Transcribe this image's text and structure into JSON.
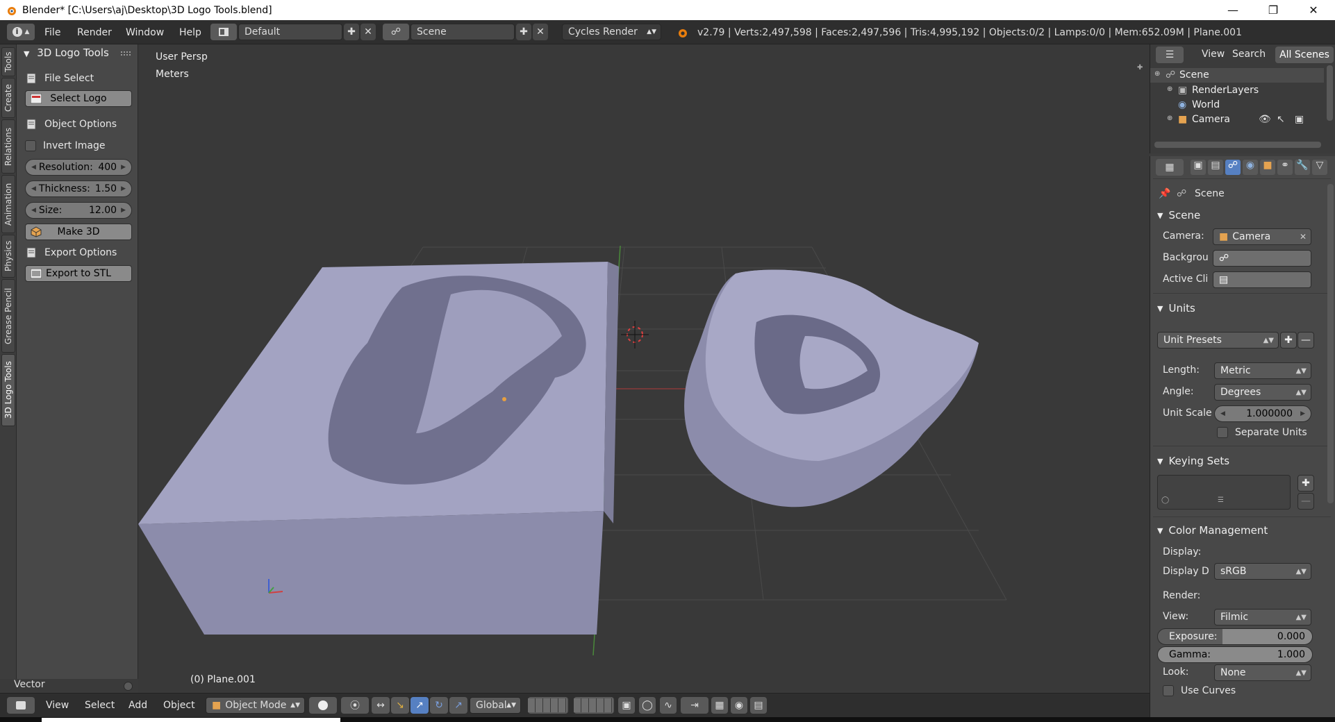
{
  "window": {
    "title": "Blender* [C:\\Users\\aj\\Desktop\\3D Logo Tools.blend]"
  },
  "infobar": {
    "menus": [
      "File",
      "Render",
      "Window",
      "Help"
    ],
    "layout": "Default",
    "scene": "Scene",
    "engine": "Cycles Render",
    "stats": "v2.79 | Verts:2,497,598 | Faces:2,497,596 | Tris:4,995,192 | Objects:0/2 | Lamps:0/0 | Mem:652.09M | Plane.001"
  },
  "tool_tabs": [
    "Tools",
    "Create",
    "Relations",
    "Animation",
    "Physics",
    "Grease Pencil",
    "3D Logo Tools"
  ],
  "tool_panel": {
    "title": "3D Logo Tools",
    "file_select": "File Select",
    "select_logo": "Select Logo",
    "object_options": "Object Options",
    "invert_image": "Invert Image",
    "resolution_label": "Resolution:",
    "resolution_value": "400",
    "thickness_label": "Thickness:",
    "thickness_value": "1.50",
    "size_label": "Size:",
    "size_value": "12.00",
    "make_3d": "Make 3D",
    "export_options": "Export Options",
    "export_stl": "Export to STL",
    "vector": "Vector"
  },
  "viewport": {
    "view_name": "User Persp",
    "units": "Meters",
    "object_label": "(0) Plane.001"
  },
  "bottombar": {
    "menus": [
      "View",
      "Select",
      "Add",
      "Object"
    ],
    "mode": "Object Mode",
    "orientation": "Global"
  },
  "outliner": {
    "view": "View",
    "search": "Search",
    "filter": "All Scenes",
    "items": [
      "Scene",
      "RenderLayers",
      "World",
      "Camera"
    ]
  },
  "properties": {
    "context": "Scene",
    "scene_section": "Scene",
    "camera_label": "Camera:",
    "camera_value": "Camera",
    "background_label": "Backgrou",
    "active_clip_label": "Active Cli",
    "units_section": "Units",
    "unit_presets": "Unit Presets",
    "length_label": "Length:",
    "length_value": "Metric",
    "angle_label": "Angle:",
    "angle_value": "Degrees",
    "unit_scale_label": "Unit Scale",
    "unit_scale_value": "1.000000",
    "separate_units": "Separate Units",
    "keying_sets_section": "Keying Sets",
    "color_mgmt_section": "Color Management",
    "display_label": "Display:",
    "display_device_label": "Display D",
    "display_device_value": "sRGB",
    "render_label": "Render:",
    "view_label": "View:",
    "view_value": "Filmic",
    "exposure_label": "Exposure:",
    "exposure_value": "0.000",
    "gamma_label": "Gamma:",
    "gamma_value": "1.000",
    "look_label": "Look:",
    "look_value": "None",
    "use_curves": "Use Curves"
  },
  "colors": {
    "accent": "#5680c2",
    "mesh": "#9a9ab8",
    "bg": "#393939"
  }
}
